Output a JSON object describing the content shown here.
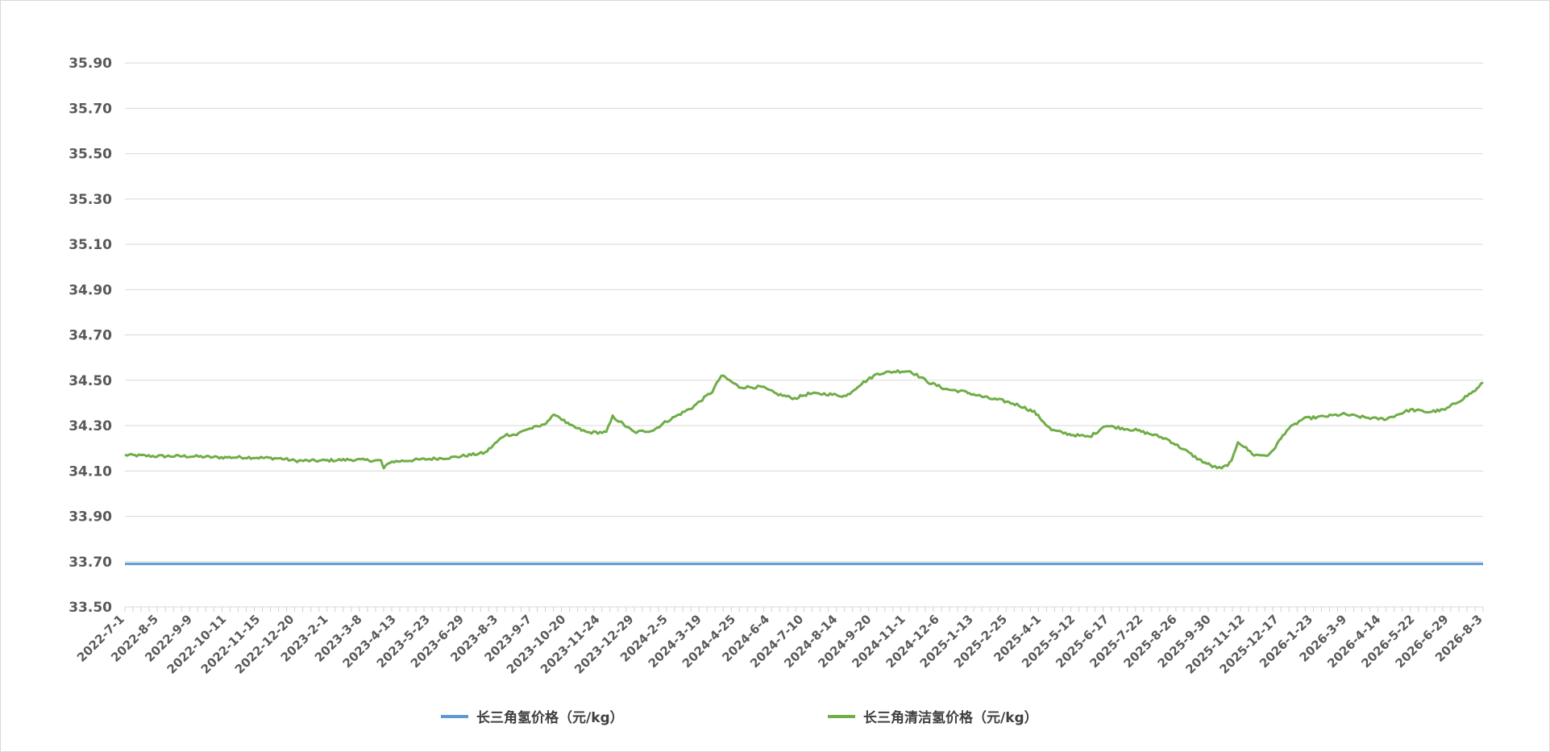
{
  "chart_data": {
    "type": "line",
    "title": "",
    "xlabel": "",
    "ylabel": "",
    "ylim": [
      33.5,
      36.0
    ],
    "y_ticks": [
      "33.50",
      "33.70",
      "33.90",
      "34.10",
      "34.30",
      "34.50",
      "34.70",
      "34.90",
      "35.10",
      "35.30",
      "35.50",
      "35.70",
      "35.90"
    ],
    "x_range": [
      "2022-07-01",
      "2026-08-10"
    ],
    "x_tick_labels": [
      "2022-7-1",
      "2022-8-5",
      "2022-9-9",
      "2022-10-11",
      "2022-11-15",
      "2022-12-20",
      "2023-2-1",
      "2023-3-8",
      "2023-4-13",
      "2023-5-23",
      "2023-6-29",
      "2023-8-3",
      "2023-9-7",
      "2023-10-20",
      "2023-11-24",
      "2023-12-29",
      "2024-2-5",
      "2024-3-19",
      "2024-4-25",
      "2024-6-4",
      "2024-7-10",
      "2024-8-14",
      "2024-9-20",
      "2024-11-1",
      "2024-12-6",
      "2025-1-13",
      "2025-2-25",
      "2025-4-1",
      "2025-5-12",
      "2025-6-17",
      "2025-7-22",
      "2025-8-26",
      "2025-9-30",
      "2025-11-12",
      "2025-12-17",
      "2026-1-23",
      "2026-3-9",
      "2026-4-14",
      "2026-5-22",
      "2026-6-29",
      "2026-8-3"
    ],
    "grid": true,
    "legend_position": "bottom",
    "series": [
      {
        "name": "长三角氢价格（元/kg）",
        "color": "#5b9bd5",
        "x": [
          "2022-07-01",
          "2026-08-10"
        ],
        "values": [
          33.69,
          33.69
        ]
      },
      {
        "name": "长三角清洁氢价格（元/kg）",
        "color": "#70ad47",
        "x": [
          "2022-07-01",
          "2022-08-05",
          "2022-09-09",
          "2022-10-11",
          "2022-11-15",
          "2022-12-20",
          "2023-01-05",
          "2023-02-01",
          "2023-03-08",
          "2023-04-10",
          "2023-04-13",
          "2023-04-20",
          "2023-05-23",
          "2023-06-29",
          "2023-08-03",
          "2023-08-25",
          "2023-09-07",
          "2023-09-15",
          "2023-10-05",
          "2023-10-20",
          "2023-11-05",
          "2023-11-24",
          "2023-12-15",
          "2023-12-22",
          "2023-12-29",
          "2024-01-15",
          "2024-02-05",
          "2024-02-20",
          "2024-03-19",
          "2024-04-10",
          "2024-04-20",
          "2024-04-25",
          "2024-05-10",
          "2024-06-04",
          "2024-06-20",
          "2024-07-10",
          "2024-07-25",
          "2024-08-14",
          "2024-09-05",
          "2024-09-20",
          "2024-10-10",
          "2024-11-01",
          "2024-11-15",
          "2024-12-06",
          "2024-12-25",
          "2025-01-13",
          "2025-02-10",
          "2025-02-25",
          "2025-03-15",
          "2025-04-01",
          "2025-04-20",
          "2025-05-12",
          "2025-06-01",
          "2025-06-12",
          "2025-06-17",
          "2025-07-05",
          "2025-07-22",
          "2025-08-10",
          "2025-08-26",
          "2025-09-15",
          "2025-09-30",
          "2025-10-15",
          "2025-10-25",
          "2025-11-05",
          "2025-11-12",
          "2025-11-30",
          "2025-12-17",
          "2026-01-05",
          "2026-01-23",
          "2026-02-15",
          "2026-03-09",
          "2026-03-25",
          "2026-04-14",
          "2026-04-25",
          "2026-05-15",
          "2026-05-22",
          "2026-06-10",
          "2026-06-29",
          "2026-07-15",
          "2026-08-03",
          "2026-08-10"
        ],
        "values": [
          34.17,
          34.165,
          34.165,
          34.16,
          34.16,
          34.155,
          34.145,
          34.145,
          34.15,
          34.145,
          34.11,
          34.14,
          34.15,
          34.16,
          34.18,
          34.26,
          34.26,
          34.28,
          34.3,
          34.35,
          34.3,
          34.27,
          34.27,
          34.34,
          34.32,
          34.27,
          34.28,
          34.32,
          34.38,
          34.45,
          34.52,
          34.51,
          34.47,
          34.47,
          34.44,
          34.42,
          34.44,
          34.44,
          34.43,
          34.48,
          34.53,
          34.54,
          34.54,
          34.49,
          34.46,
          34.45,
          34.42,
          34.41,
          34.39,
          34.36,
          34.28,
          34.26,
          34.25,
          34.28,
          34.3,
          34.29,
          34.28,
          34.26,
          34.24,
          34.19,
          34.15,
          34.12,
          34.11,
          34.14,
          34.23,
          34.17,
          34.17,
          34.28,
          34.33,
          34.34,
          34.35,
          34.34,
          34.33,
          34.33,
          34.36,
          34.37,
          34.36,
          34.37,
          34.41,
          34.46,
          34.49
        ]
      }
    ]
  }
}
